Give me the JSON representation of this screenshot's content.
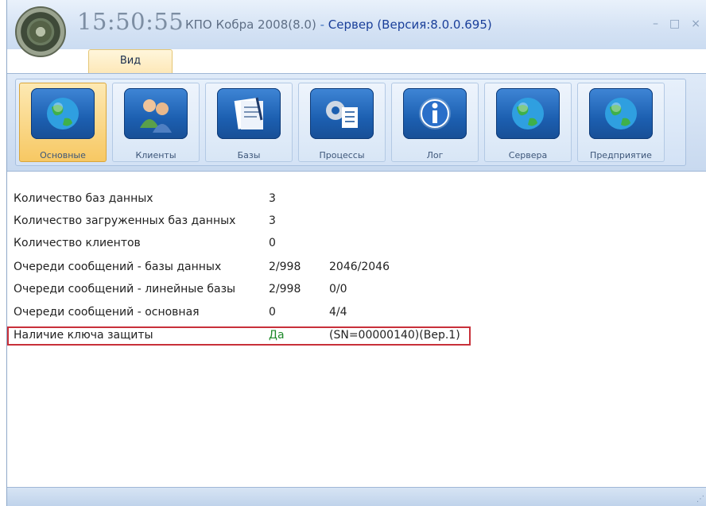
{
  "titlebar": {
    "time": "15:50:55",
    "app_name": "КПО Кобра 2008(8.0)",
    "separator": " - ",
    "server_info": "Сервер (Версия:8.0.0.695)",
    "minimize": "–",
    "maximize": "□",
    "close": "×"
  },
  "tabs": [
    {
      "label": "Вид"
    }
  ],
  "ribbon": {
    "buttons": [
      {
        "label": "Основные",
        "icon": "globe-icon"
      },
      {
        "label": "Клиенты",
        "icon": "users-icon"
      },
      {
        "label": "Базы",
        "icon": "documents-icon"
      },
      {
        "label": "Процессы",
        "icon": "gear-list-icon"
      },
      {
        "label": "Лог",
        "icon": "info-icon"
      },
      {
        "label": "Сервера",
        "icon": "globe-icon"
      },
      {
        "label": "Предприятие",
        "icon": "globe-icon"
      }
    ]
  },
  "stats": [
    {
      "name": "Количество баз данных",
      "value": "3",
      "extra": ""
    },
    {
      "name": "Количество загруженных баз данных",
      "value": "3",
      "extra": ""
    },
    {
      "name": "Количество клиентов",
      "value": "0",
      "extra": ""
    },
    {
      "name": "Очереди сообщений - базы данных",
      "value": "2/998",
      "extra": "2046/2046"
    },
    {
      "name": "Очереди сообщений - линейные базы",
      "value": "2/998",
      "extra": "0/0"
    },
    {
      "name": "Очереди сообщений - основная",
      "value": "0",
      "extra": "4/4"
    },
    {
      "name": "Наличие ключа защиты",
      "value": "Да",
      "extra": "(SN=00000140)(Вер.1)"
    }
  ],
  "colors": {
    "highlight_border": "#c8303a",
    "yes_text": "#1f8a2b",
    "active_button": "#f7c863"
  }
}
